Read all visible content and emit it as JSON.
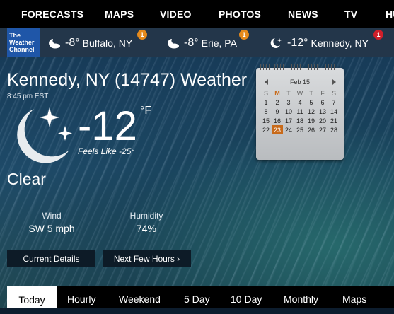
{
  "nav": [
    "FORECASTS",
    "MAPS",
    "VIDEO",
    "PHOTOS",
    "NEWS",
    "TV",
    "HU"
  ],
  "logo": [
    "The",
    "Weather",
    "Channel"
  ],
  "locations": [
    {
      "temp": "-8°",
      "name": "Buffalo, NY",
      "badge": "1",
      "icon": "moon-cloud-icon",
      "badge_color": "#e58a1c"
    },
    {
      "temp": "-8°",
      "name": "Erie, PA",
      "badge": "1",
      "icon": "moon-cloud-icon",
      "badge_color": "#e58a1c"
    },
    {
      "temp": "-12°",
      "name": "Kennedy, NY",
      "badge": "1",
      "icon": "moon-star-icon",
      "badge_color": "#d01f2a"
    }
  ],
  "main": {
    "title": "Kennedy, NY (14747) Weather",
    "time": "8:45 pm EST",
    "temp": "-12",
    "unit": "°F",
    "feels": "Feels Like -25°",
    "condition": "Clear"
  },
  "stats": [
    {
      "label": "Wind",
      "value": "SW 5 mph"
    },
    {
      "label": "Humidity",
      "value": "74%"
    }
  ],
  "buttons": {
    "current": "Current Details",
    "next": "Next Few Hours ›"
  },
  "calendar": {
    "month": "Feb 15",
    "days_header": [
      "S",
      "M",
      "T",
      "W",
      "T",
      "F",
      "S"
    ],
    "weeks": [
      [
        "1",
        "2",
        "3",
        "4",
        "5",
        "6",
        "7"
      ],
      [
        "8",
        "9",
        "10",
        "11",
        "12",
        "13",
        "14"
      ],
      [
        "15",
        "16",
        "17",
        "18",
        "19",
        "20",
        "21"
      ],
      [
        "22",
        "23",
        "24",
        "25",
        "26",
        "27",
        "28"
      ]
    ],
    "today": "23"
  },
  "tabs": [
    "Today",
    "Hourly",
    "Weekend",
    "5 Day",
    "10 Day",
    "Monthly",
    "Maps"
  ],
  "active_tab": "Today"
}
